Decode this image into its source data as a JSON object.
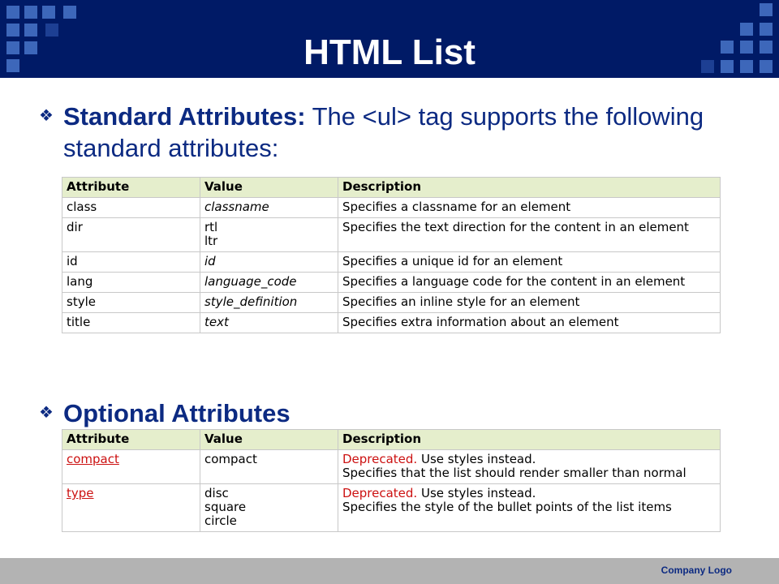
{
  "slide": {
    "title": "HTML List",
    "footer_logo": "Company Logo"
  },
  "standard_section": {
    "heading": "Standard Attributes:",
    "text_part1": " The ",
    "tag": "<ul>",
    "text_part2": " tag supports the following standard attributes:",
    "columns": [
      "Attribute",
      "Value",
      "Description"
    ],
    "rows": [
      {
        "attribute": "class",
        "value": "classname",
        "description": "Specifies a classname for an element"
      },
      {
        "attribute": "dir",
        "value_line1": "rtl",
        "value_line2": "ltr",
        "description": "Specifies the text direction for the content in an element"
      },
      {
        "attribute": "id",
        "value": "id",
        "description": "Specifies a unique id for an element"
      },
      {
        "attribute": "lang",
        "value": "language_code",
        "description": "Specifies a language code for the content in an element"
      },
      {
        "attribute": "style",
        "value": "style_definition",
        "description": "Specifies an inline style for an element"
      },
      {
        "attribute": "title",
        "value": "text",
        "description": "Specifies extra information about an element"
      }
    ]
  },
  "optional_section": {
    "heading": "Optional Attributes",
    "columns": [
      "Attribute",
      "Value",
      "Description"
    ],
    "rows": [
      {
        "attribute": "compact",
        "value": "compact",
        "deprecated": "Deprecated.",
        "deprecated_note": " Use styles instead.",
        "description": "Specifies that the list should render smaller than normal"
      },
      {
        "attribute": "type",
        "value_line1": "disc",
        "value_line2": "square",
        "value_line3": "circle",
        "deprecated": "Deprecated.",
        "deprecated_note": " Use styles instead.",
        "description": "Specifies the style of the bullet points of the list items"
      }
    ]
  },
  "colors": {
    "banner": "#001a66",
    "text": "#0c2a82",
    "table_header": "#e5eecc",
    "deprecated": "#cc1111"
  },
  "icons": {
    "bullet": "diamond-bullet-icon"
  }
}
